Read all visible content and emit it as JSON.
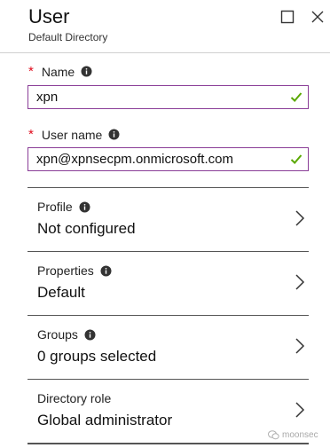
{
  "header": {
    "title": "User",
    "subtitle": "Default Directory",
    "maximize_icon": "maximize-icon",
    "close_icon": "close-icon"
  },
  "form": {
    "name": {
      "label": "Name",
      "required": "*",
      "value": "xpn",
      "valid": true
    },
    "user_name": {
      "label": "User name",
      "required": "*",
      "value": "xpn@xpnsecpm.onmicrosoft.com",
      "valid": true
    }
  },
  "sections": [
    {
      "label": "Profile",
      "value": "Not configured"
    },
    {
      "label": "Properties",
      "value": "Default"
    },
    {
      "label": "Groups",
      "value": "0 groups selected"
    },
    {
      "label": "Directory role",
      "value": "Global administrator"
    }
  ],
  "watermark": {
    "text": "moonsec"
  },
  "colors": {
    "accent_border": "#8a3d97",
    "required": "#e00b1c",
    "valid_check": "#5aa800"
  }
}
